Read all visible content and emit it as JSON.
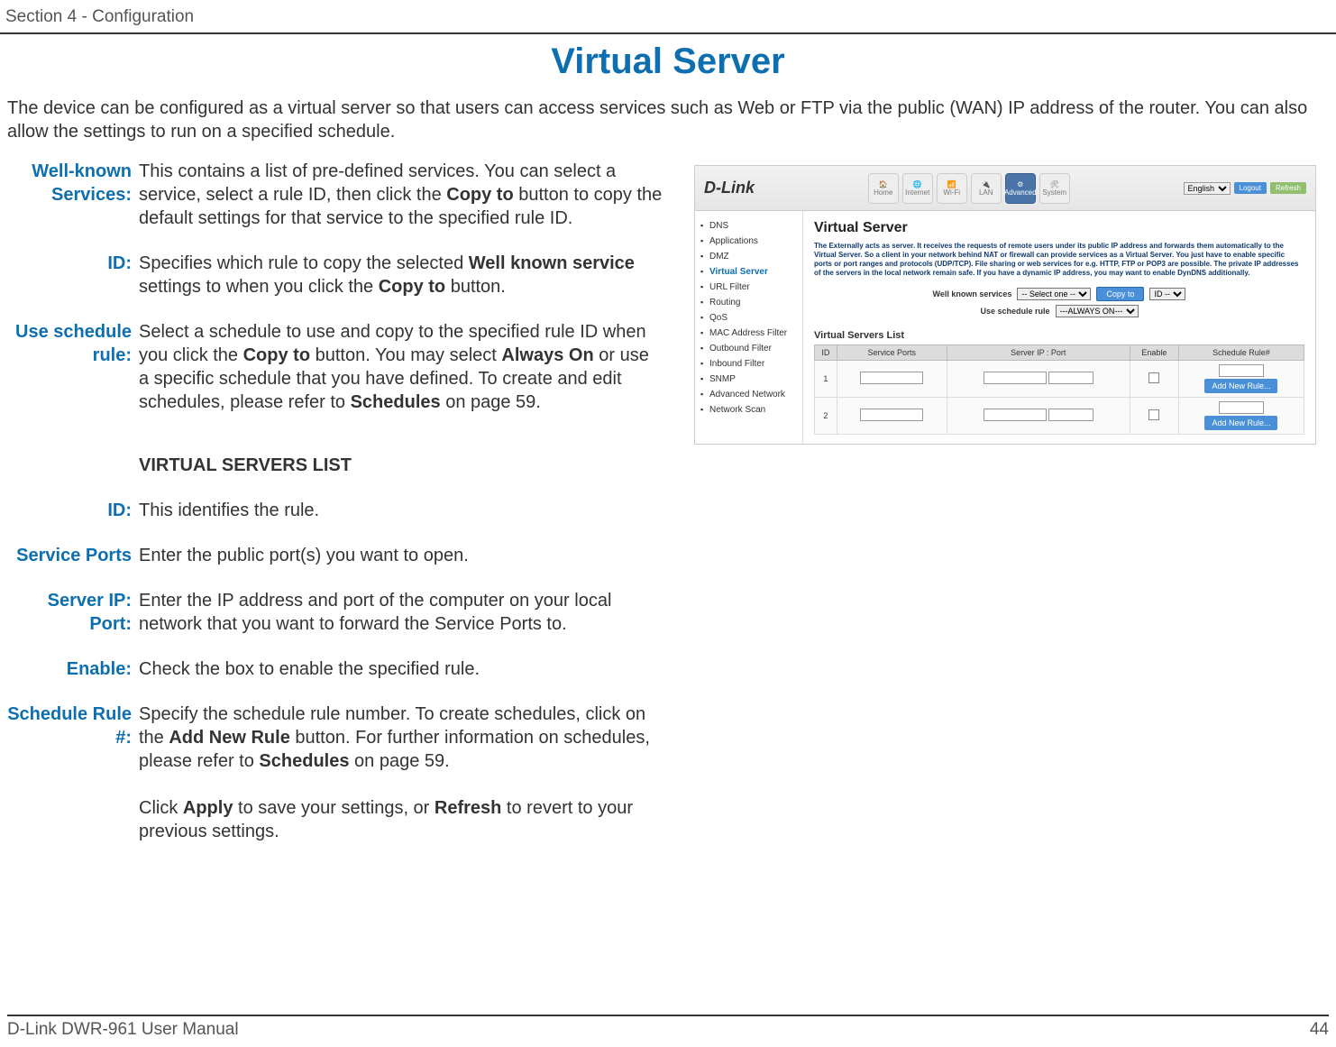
{
  "header": {
    "section": "Section 4 - Configuration"
  },
  "title": "Virtual Server",
  "intro": "The device can be configured as a virtual server so that users can access services such as Web or FTP via the public (WAN) IP address of the router. You can also allow the settings to run on a specified schedule.",
  "defs": {
    "well_known_label": "Well-known Services:",
    "well_known_desc_1": "This contains a list of pre-defined services. You can select a service, select a rule ID, then click the ",
    "well_known_bold_1": "Copy to",
    "well_known_desc_2": " button to copy the default settings for that service to the specified rule ID.",
    "id1_label": "ID:",
    "id1_desc_1": "Specifies which rule to copy the selected ",
    "id1_bold_1": "Well known service",
    "id1_desc_2": " settings to when you click the ",
    "id1_bold_2": "Copy to",
    "id1_desc_3": " button.",
    "use_sched_label": "Use schedule rule:",
    "use_sched_desc_1": "Select a schedule to use and copy to the specified rule ID when you click the ",
    "use_sched_bold_1": "Copy to",
    "use_sched_desc_2": " button. You may select ",
    "use_sched_bold_2": "Always On",
    "use_sched_desc_3": " or use a specific schedule that you have defined. To create and edit schedules, please refer to ",
    "use_sched_bold_3": "Schedules",
    "use_sched_desc_4": " on page 59.",
    "vsl_heading": "VIRTUAL SERVERS LIST",
    "id2_label": "ID:",
    "id2_desc": "This identifies the rule.",
    "service_ports_label": "Service Ports",
    "service_ports_desc": "Enter the public port(s) you want to open.",
    "server_ip_label": "Server IP: Port:",
    "server_ip_desc": "Enter the IP address and port of the computer on your local network that you want to forward the Service Ports to.",
    "enable_label": "Enable:",
    "enable_desc": "Check the box to enable the specified rule.",
    "sched_rule_label": "Schedule Rule #:",
    "sched_rule_desc_1": "Specify the schedule rule number. To create schedules, click on the ",
    "sched_rule_bold_1": "Add New Rule",
    "sched_rule_desc_2": " button. For further information on schedules, please refer to ",
    "sched_rule_bold_2": "Schedules",
    "sched_rule_desc_3": " on page 59.",
    "apply_desc_1": "Click ",
    "apply_bold_1": "Apply",
    "apply_desc_2": " to save your settings, or ",
    "apply_bold_2": "Refresh",
    "apply_desc_3": " to revert to your previous settings."
  },
  "screenshot": {
    "logo": "D-Link",
    "nav": [
      "Home",
      "Internet",
      "Wi-Fi",
      "LAN",
      "Advanced",
      "System"
    ],
    "nav_selected": "Advanced",
    "lang_label": "English",
    "btn_logout": "Logout",
    "btn_refresh": "Refresh",
    "sidebar": [
      "DNS",
      "Applications",
      "DMZ",
      "Virtual Server",
      "URL Filter",
      "Routing",
      "QoS",
      "MAC Address Filter",
      "Outbound Filter",
      "Inbound Filter",
      "SNMP",
      "Advanced Network",
      "Network Scan"
    ],
    "sidebar_selected": "Virtual Server",
    "panel_title": "Virtual Server",
    "panel_desc": "The Externally acts as server. It receives the requests of remote users under its public IP address and forwards them automatically to the Virtual Server. So a client in your network behind NAT or firewall can provide services as a Virtual Server. You just have to enable specific ports or port ranges and protocols (UDP/TCP). File sharing or web services for e.g. HTTP, FTP or POP3 are possible. The private IP addresses of the servers in the local network remain safe. If you have a dynamic IP address, you may want to enable DynDNS additionally.",
    "wk_label": "Well known services",
    "wk_select": "-- Select one --",
    "copy_to": "Copy to",
    "id_select": "ID --",
    "usr_label": "Use schedule rule",
    "usr_select": "---ALWAYS ON---",
    "list_title": "Virtual Servers List",
    "cols": [
      "ID",
      "Service Ports",
      "Server IP : Port",
      "Enable",
      "Schedule Rule#"
    ],
    "rows": [
      {
        "id": "1",
        "btn": "Add New Rule..."
      },
      {
        "id": "2",
        "btn": "Add New Rule..."
      }
    ]
  },
  "footer": {
    "left": "D-Link DWR-961 User Manual",
    "right": "44"
  }
}
